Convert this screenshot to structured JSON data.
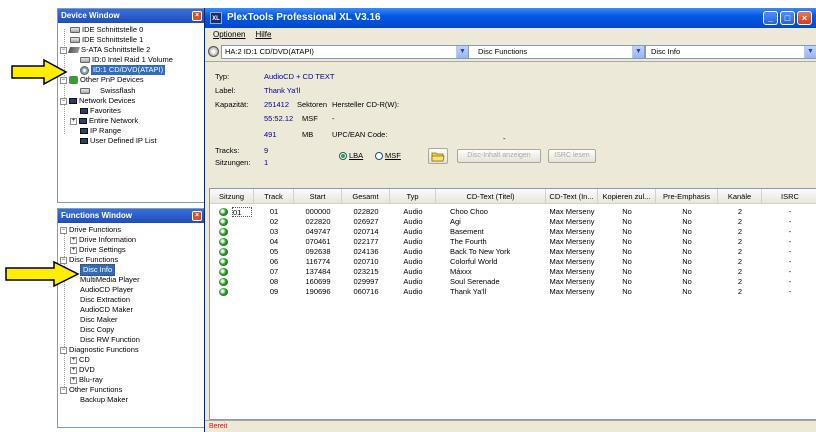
{
  "device_window": {
    "title": "Device Window",
    "items": [
      {
        "label": "IDE Schnittstelle 0"
      },
      {
        "label": "IDE Schnittstelle 1"
      },
      {
        "label": "S-ATA Schnittstelle 2"
      },
      {
        "label": "ID:0  Intel   Raid 1 Volume"
      },
      {
        "label": "ID:1  CD/DVD(ATAPI)"
      },
      {
        "label": "Other PnP Devices"
      },
      {
        "label": "Swissflash"
      },
      {
        "label": "Network Devices"
      },
      {
        "label": "Favorites"
      },
      {
        "label": "Entire Network"
      },
      {
        "label": "IP Range"
      },
      {
        "label": "User Defined IP List"
      }
    ]
  },
  "functions_window": {
    "title": "Functions Window",
    "items": [
      {
        "label": "Drive Functions"
      },
      {
        "label": "Drive Information"
      },
      {
        "label": "Drive Settings"
      },
      {
        "label": "Disc Functions"
      },
      {
        "label": "Disc Info"
      },
      {
        "label": "MultiMedia Player"
      },
      {
        "label": "AudioCD Player"
      },
      {
        "label": "Disc Extraction"
      },
      {
        "label": "AudioCD Maker"
      },
      {
        "label": "Disc Maker"
      },
      {
        "label": "Disc Copy"
      },
      {
        "label": "Disc RW Function"
      },
      {
        "label": "Diagnostic Functions"
      },
      {
        "label": "CD"
      },
      {
        "label": "DVD"
      },
      {
        "label": "Blu-ray"
      },
      {
        "label": "Other Functions"
      },
      {
        "label": "Backup Maker"
      }
    ]
  },
  "main": {
    "app_icon": "XL",
    "title": "PlexTools Professional XL V3.16",
    "menu": [
      "Optionen",
      "Hilfe"
    ],
    "device_select": "HA:2 ID:1  CD/DVD(ATAPI)",
    "function_select": "Disc Functions",
    "subfunction_select": "Disc Info",
    "info": {
      "typ_label": "Typ:",
      "typ_value": "AudioCD + CD TEXT",
      "label_label": "Label:",
      "label_value": "Thank Ya'll",
      "kapazitaet_label": "Kapazität:",
      "sectors_value": "251412",
      "sectors_unit": "Sektoren",
      "hersteller_label": "Hersteller CD-R(W):",
      "msf_value": "55:52.12",
      "msf_unit": "MSF",
      "msf_dash": "-",
      "mb_value": "491",
      "mb_unit": "MB",
      "upc_label": "UPC/EAN Code:",
      "upc_value": "-",
      "tracks_label": "Tracks:",
      "tracks_value": "9",
      "sessions_label": "Sitzungen:",
      "sessions_value": "1",
      "radio_lba": "LBA",
      "radio_msf": "MSF",
      "btn_disc_content": "Disc-Inhalt anzeigen",
      "btn_isrc": "ISRC lesen"
    },
    "table": {
      "columns": [
        "Sitzung",
        "Track",
        "Start",
        "Gesamt",
        "Typ",
        "CD-Text (Titel)",
        "CD-Text (In...",
        "Kopieren zul...",
        "Pre-Emphasis",
        "Kanäle",
        "ISRC"
      ],
      "rows": [
        [
          "01",
          "01",
          "000000",
          "022820",
          "Audio",
          "Choo Choo",
          "Max Merseny",
          "No",
          "No",
          "2",
          "-"
        ],
        [
          "",
          "02",
          "022820",
          "026927",
          "Audio",
          "Agi",
          "Max Merseny",
          "No",
          "No",
          "2",
          "-"
        ],
        [
          "",
          "03",
          "049747",
          "020714",
          "Audio",
          "Basement",
          "Max Merseny",
          "No",
          "No",
          "2",
          "-"
        ],
        [
          "",
          "04",
          "070461",
          "022177",
          "Audio",
          "The Fourth",
          "Max Merseny",
          "No",
          "No",
          "2",
          "-"
        ],
        [
          "",
          "05",
          "092638",
          "024136",
          "Audio",
          "Back To New York",
          "Max Merseny",
          "No",
          "No",
          "2",
          "-"
        ],
        [
          "",
          "06",
          "116774",
          "020710",
          "Audio",
          "Colorful World",
          "Max Merseny",
          "No",
          "No",
          "2",
          "-"
        ],
        [
          "",
          "07",
          "137484",
          "023215",
          "Audio",
          "Máxxx",
          "Max Merseny",
          "No",
          "No",
          "2",
          "-"
        ],
        [
          "",
          "08",
          "160699",
          "029997",
          "Audio",
          "Soul Serenade",
          "Max Merseny",
          "No",
          "No",
          "2",
          "-"
        ],
        [
          "",
          "09",
          "190696",
          "060716",
          "Audio",
          "Thank Ya'll",
          "Max Merseny",
          "No",
          "No",
          "2",
          "-"
        ]
      ]
    },
    "status": "Bereit"
  },
  "colors": {
    "arrow_fill": "#ffee00",
    "selection": "#316ac5",
    "title_blue": "#0058e6"
  }
}
